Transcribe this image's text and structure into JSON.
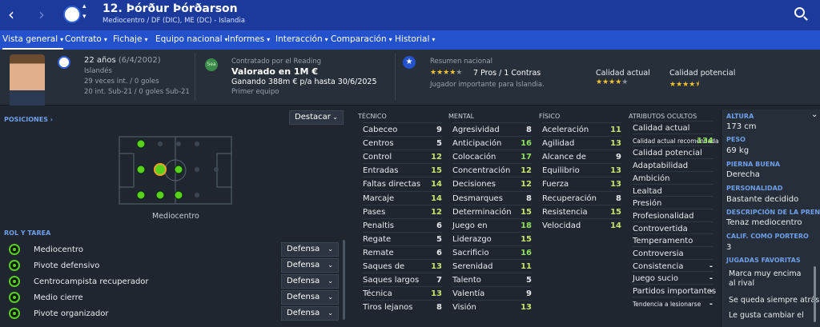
{
  "header": {
    "player_name": "12. Þórður Þórðarson",
    "subtitle": "Mediocentro / DF (DIC), ME (DC) - Islandia"
  },
  "nav": [
    {
      "label": "Vista general"
    },
    {
      "label": "Contrato"
    },
    {
      "label": "Fichaje"
    },
    {
      "label": "Equipo nacional"
    },
    {
      "label": "Informes"
    },
    {
      "label": "Interacción"
    },
    {
      "label": "Comparación"
    },
    {
      "label": "Historial"
    }
  ],
  "profile": {
    "age": "22 años",
    "dob": "(6/4/2002)",
    "nationality": "Islandés",
    "caps": "29 veces int. / 0 goles",
    "u21": "20 int. Sub-21 / 0 goles Sub-21"
  },
  "contract": {
    "badge": "Sea",
    "loan": "Contratado por el Reading",
    "value": "Valorado en 1M €",
    "wage": "Ganando 388m € p/a hasta 30/6/2025",
    "squad": "Primer equipo"
  },
  "national": {
    "label": "Resumen nacional",
    "stars_filled": 4,
    "stars_total": 5,
    "pros_cons": "7 Pros / 1 Contras",
    "desc": "Jugador importante para Islandia."
  },
  "ability": {
    "current_label": "Calidad actual",
    "current_stars": 4,
    "potential_label": "Calidad potencial",
    "potential_stars": 4.5
  },
  "positions": {
    "title": "POSICIONES",
    "dropdown": "Destacar",
    "pitch_label": "Mediocentro"
  },
  "roles": {
    "title": "ROL Y TAREA",
    "items": [
      {
        "name": "Mediocentro",
        "duty": "Defensa"
      },
      {
        "name": "Pivote defensivo",
        "duty": "Defensa"
      },
      {
        "name": "Centrocampista recuperador",
        "duty": "Defensa"
      },
      {
        "name": "Medio cierre",
        "duty": "Defensa"
      },
      {
        "name": "Pivote organizador",
        "duty": "Defensa"
      }
    ]
  },
  "attributes": {
    "technical_title": "TÉCNICO",
    "mental_title": "MENTAL",
    "physical_title": "FÍSICO",
    "hidden_title": "ATRIBUTOS OCULTOS",
    "technical": [
      {
        "name": "Cabeceo",
        "value": "9"
      },
      {
        "name": "Centros",
        "value": "5"
      },
      {
        "name": "Control",
        "value": "12"
      },
      {
        "name": "Entradas",
        "value": "15"
      },
      {
        "name": "Faltas directas",
        "value": "14"
      },
      {
        "name": "Marcaje",
        "value": "14"
      },
      {
        "name": "Pases",
        "value": "12"
      },
      {
        "name": "Penaltis",
        "value": "6"
      },
      {
        "name": "Regate",
        "value": "5"
      },
      {
        "name": "Remate",
        "value": "6"
      },
      {
        "name": "Saques de",
        "value": "13"
      },
      {
        "name": "Saques largos",
        "value": "7"
      },
      {
        "name": "Técnica",
        "value": "13"
      },
      {
        "name": "Tiros lejanos",
        "value": "8"
      }
    ],
    "mental": [
      {
        "name": "Agresividad",
        "value": "8"
      },
      {
        "name": "Anticipación",
        "value": "16"
      },
      {
        "name": "Colocación",
        "value": "17"
      },
      {
        "name": "Concentración",
        "value": "12"
      },
      {
        "name": "Decisiones",
        "value": "12"
      },
      {
        "name": "Desmarques",
        "value": "8"
      },
      {
        "name": "Determinación",
        "value": "15"
      },
      {
        "name": "Juego en",
        "value": "18"
      },
      {
        "name": "Liderazgo",
        "value": "15"
      },
      {
        "name": "Sacrificio",
        "value": "16"
      },
      {
        "name": "Serenidad",
        "value": "11"
      },
      {
        "name": "Talento",
        "value": "5"
      },
      {
        "name": "Valentía",
        "value": "9"
      },
      {
        "name": "Visión",
        "value": "13"
      }
    ],
    "physical": [
      {
        "name": "Aceleración",
        "value": "11"
      },
      {
        "name": "Agilidad",
        "value": "13"
      },
      {
        "name": "Alcance de",
        "value": "9"
      },
      {
        "name": "Equilibrio",
        "value": "13"
      },
      {
        "name": "Fuerza",
        "value": "13"
      },
      {
        "name": "Recuperación",
        "value": "8"
      },
      {
        "name": "Resistencia",
        "value": "15"
      },
      {
        "name": "Velocidad",
        "value": "14"
      }
    ],
    "hidden": [
      {
        "name": "Calidad actual",
        "value": ""
      },
      {
        "name": "Calidad actual recomendada",
        "value": "134"
      },
      {
        "name": "Calidad potencial",
        "value": ""
      },
      {
        "name": "Adaptabilidad",
        "value": ""
      },
      {
        "name": "Ambición",
        "value": ""
      },
      {
        "name": "Lealtad",
        "value": ""
      },
      {
        "name": "Presión",
        "value": ""
      },
      {
        "name": "Profesionalidad",
        "value": ""
      },
      {
        "name": "Controvertida",
        "value": ""
      },
      {
        "name": "Temperamento",
        "value": ""
      },
      {
        "name": "Controversia",
        "value": ""
      },
      {
        "name": "Consistencia",
        "value": "-"
      },
      {
        "name": "Juego sucio",
        "value": "-"
      },
      {
        "name": "Partidos importantes",
        "value": "-"
      },
      {
        "name": "Tendencia a lesionarse",
        "value": "-"
      }
    ]
  },
  "info": {
    "height_label": "ALTURA",
    "height": "173 cm",
    "weight_label": "PESO",
    "weight": "69 kg",
    "foot_label": "PIERNA BUENA",
    "foot": "Derecha",
    "personality_label": "PERSONALIDAD",
    "personality": "Bastante decidido",
    "press_label": "DESCRIPCIÓN DE LA PRENSA",
    "press": "Tenaz mediocentro",
    "gk_label": "CALIF. COMO PORTERO",
    "gk": "3",
    "moves_label": "JUGADAS FAVORITAS",
    "moves": [
      "Marca muy encima al rival",
      "Se queda siempre atrás",
      "Le gusta cambiar el"
    ]
  },
  "colors": {
    "accent": "#2452cc",
    "top": "#1b3a9c",
    "good": "#8ee05a",
    "star": "#f2c12e"
  }
}
